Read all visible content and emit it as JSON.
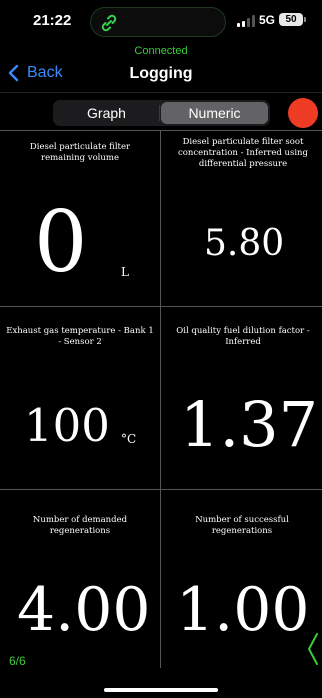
{
  "status_bar": {
    "time": "21:22",
    "network": "5G",
    "battery": "50"
  },
  "connection": {
    "status": "Connected"
  },
  "nav": {
    "back_label": "Back",
    "title": "Logging"
  },
  "view_toggle": {
    "options": [
      "Graph",
      "Numeric"
    ],
    "selected": "Numeric"
  },
  "cells": [
    {
      "label": "Diesel particulate filter remaining volume",
      "value": "0",
      "unit": "L"
    },
    {
      "label": "Diesel particulate filter soot concentration  -  Inferred using differential pressure",
      "value": "5.80",
      "unit": ""
    },
    {
      "label": "Exhaust gas temperature  -  Bank 1  -  Sensor 2",
      "value": "100",
      "unit": "°C"
    },
    {
      "label": "Oil quality fuel dilution factor  -  Inferred",
      "value": "1.37",
      "unit": ""
    },
    {
      "label": "Number of demanded regenerations",
      "value": "4.00",
      "unit": ""
    },
    {
      "label": "Number of successful regenerations",
      "value": "1.00",
      "unit": ""
    }
  ],
  "pager": {
    "text": "6/6"
  },
  "colors": {
    "accent_green": "#3ccb3c",
    "link_blue": "#3b8bff",
    "record_red": "#ee3b24"
  },
  "icons": [
    "link-icon",
    "signal-icon",
    "battery-icon",
    "chevron-left-icon",
    "record-button",
    "chevron-right-icon"
  ]
}
